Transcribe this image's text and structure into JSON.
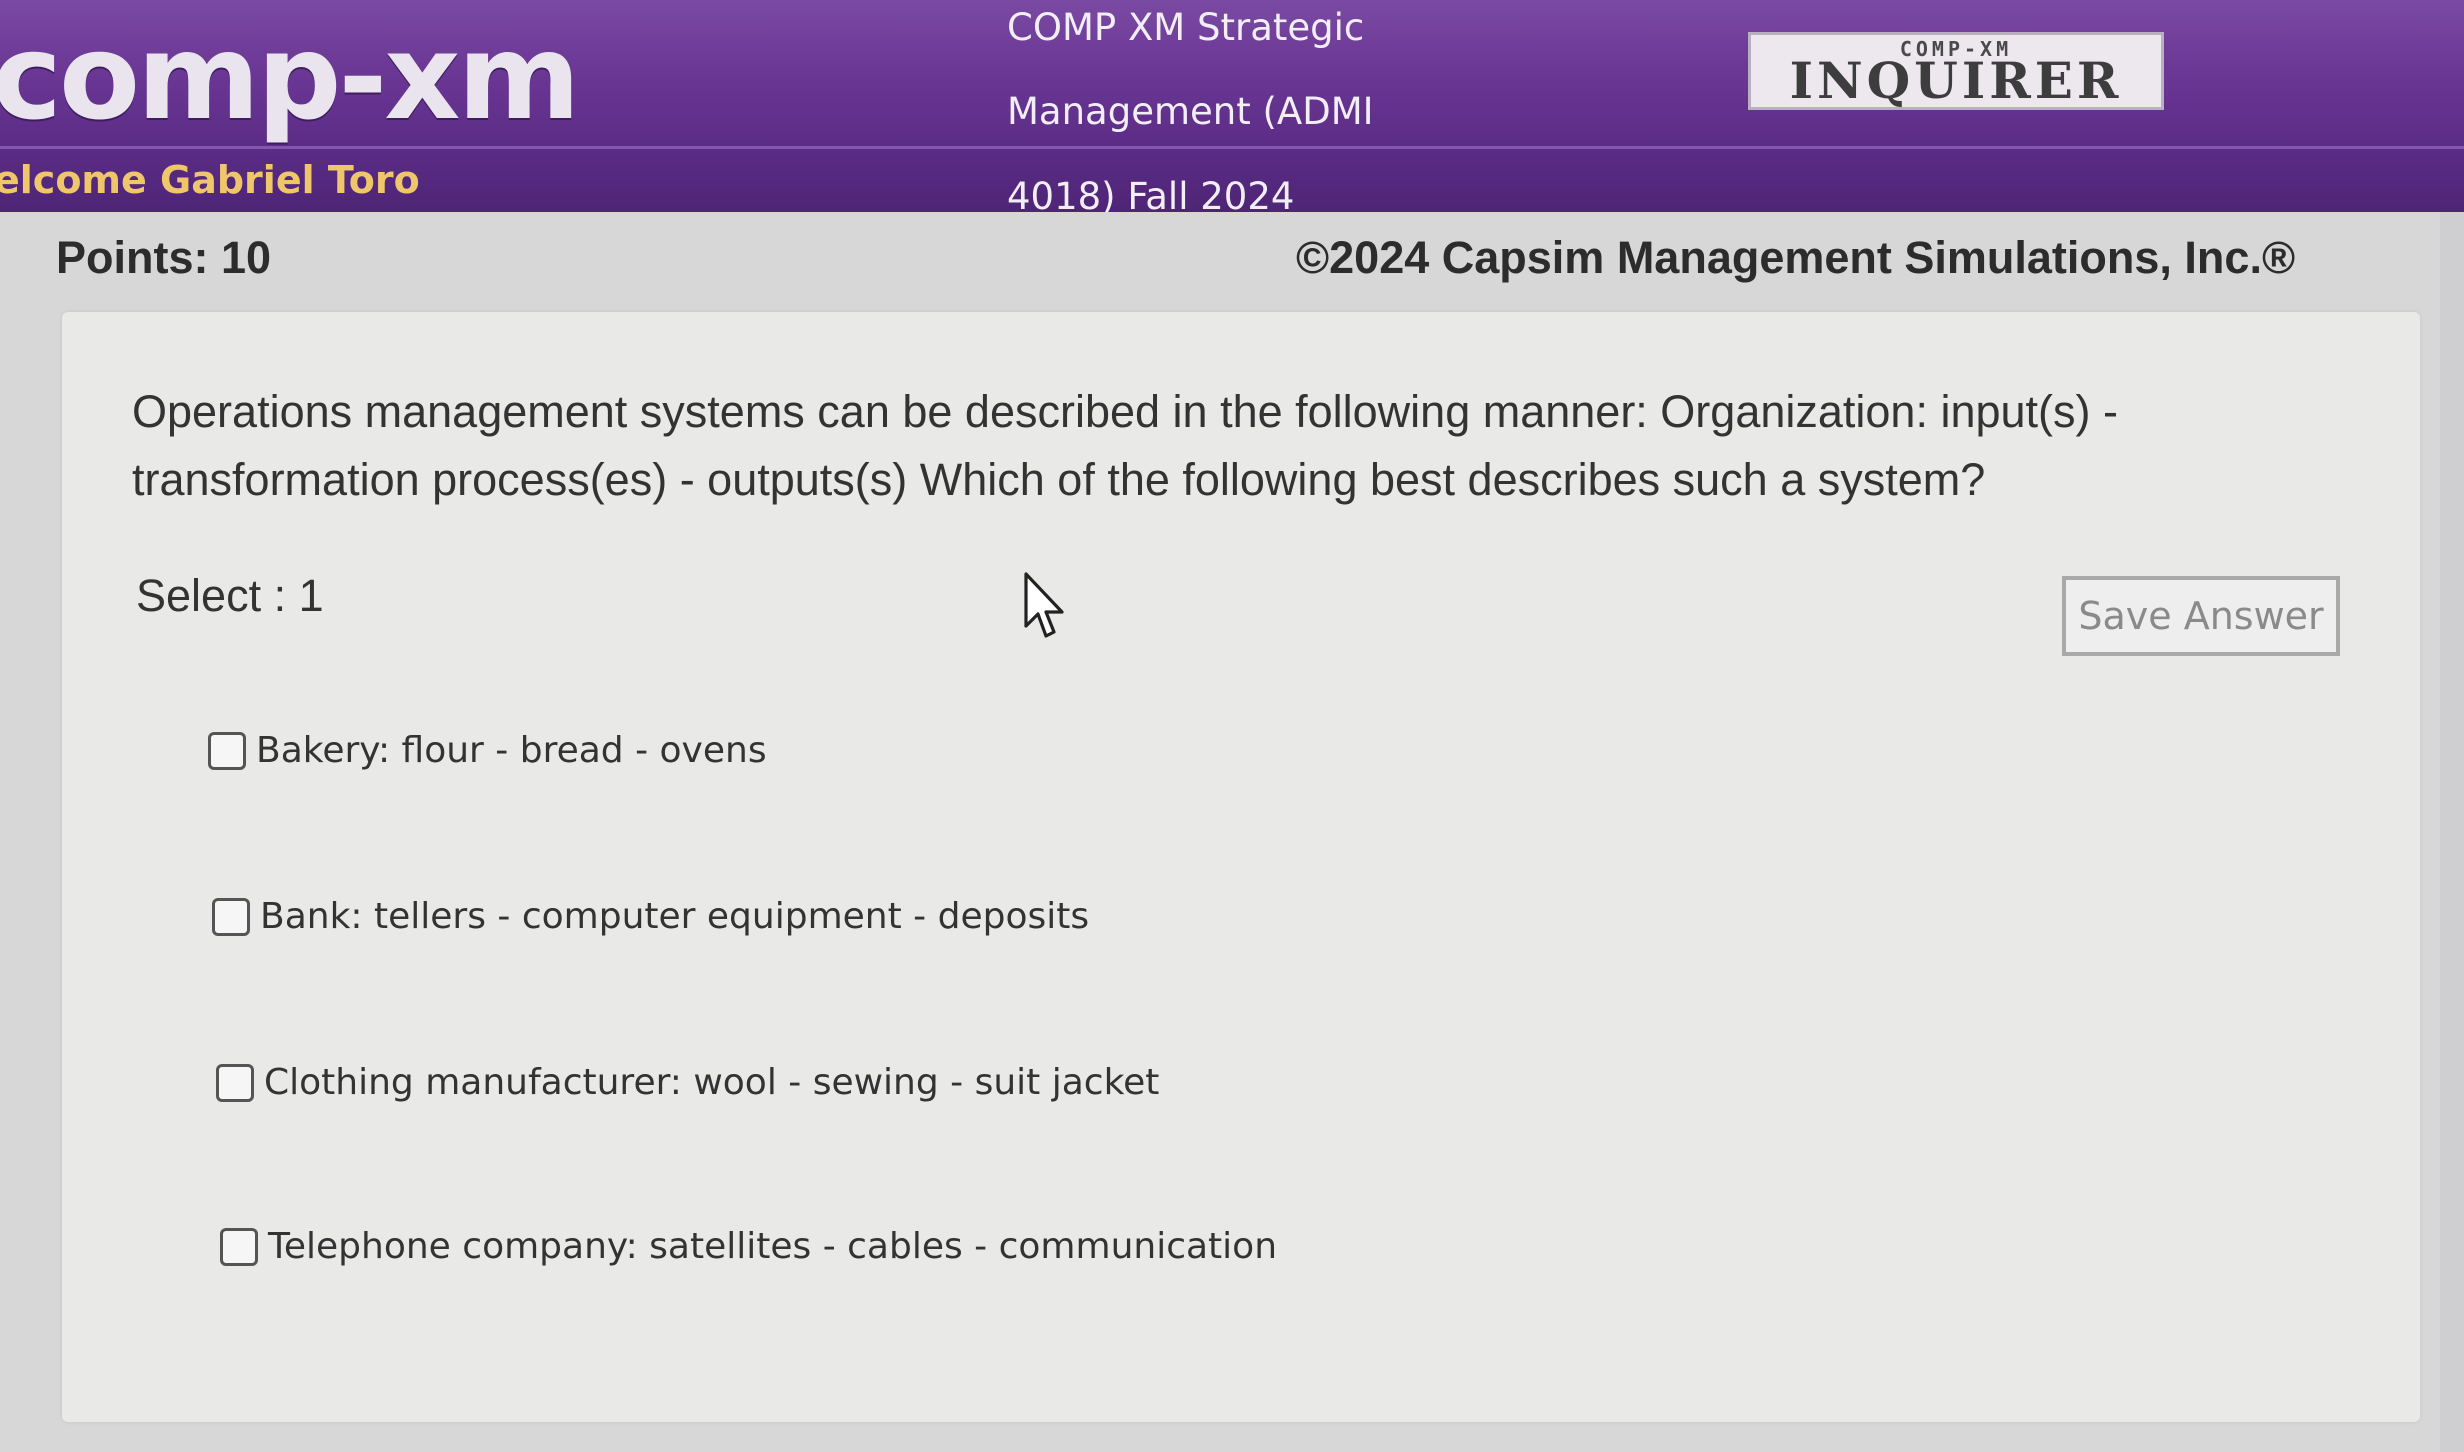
{
  "header": {
    "logo_text": "comp-xm",
    "welcome_text": "elcome Gabriel Toro",
    "course_lines": [
      "COMP XM Strategic",
      "Management (ADMI",
      "4018) Fall 2024"
    ],
    "inquirer_top": "COMP-XM",
    "inquirer_main": "INQUIRER"
  },
  "meta": {
    "points": "Points: 10",
    "copyright": "©2024 Capsim Management Simulations, Inc.®"
  },
  "question": {
    "text": "Operations management systems can be described in the following manner: Organization: input(s) - transformation process(es) - outputs(s) Which of the following best describes such a system?",
    "select_label": "Select : 1",
    "save_label": "Save Answer",
    "options": [
      {
        "label": "Bakery: flour - bread - ovens",
        "checked": false
      },
      {
        "label": "Bank: tellers - computer equipment - deposits",
        "checked": false
      },
      {
        "label": "Clothing manufacturer: wool - sewing - suit jacket",
        "checked": false
      },
      {
        "label": "Telephone company: satellites - cables - communication",
        "checked": false
      }
    ]
  },
  "colors": {
    "header_purple": "#5b2c86",
    "welcome_gold": "#f0c66a"
  },
  "icons": {
    "cursor": "mouse-pointer-icon"
  }
}
